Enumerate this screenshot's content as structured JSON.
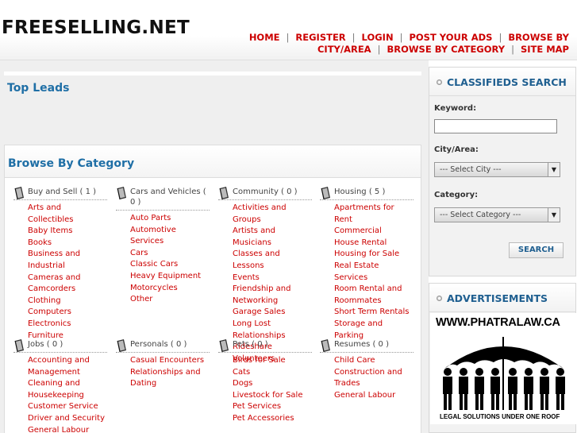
{
  "site": {
    "logo": "FREESELLING.NET"
  },
  "nav": {
    "row1": [
      "HOME",
      "REGISTER",
      "LOGIN",
      "POST YOUR ADS",
      "BROWSE BY"
    ],
    "row2": [
      "CITY/AREA",
      "BROWSE BY CATEGORY",
      "SITE MAP"
    ]
  },
  "top_leads": {
    "title": "Top Leads"
  },
  "browse": {
    "title": "Browse By Category",
    "categories": [
      {
        "name": "Buy and Sell ( 1 )",
        "items": [
          "Arts and Collectibles",
          "Baby Items",
          "Books",
          "Business and Industrial",
          "Cameras and Camcorders",
          "Clothing",
          "Computers",
          "Electronics",
          "Furniture"
        ]
      },
      {
        "name": "Cars and Vehicles ( 0 )",
        "items": [
          "Auto Parts",
          "Automotive Services",
          "Cars",
          "Classic Cars",
          "Heavy Equipment",
          "Motorcycles",
          "Other"
        ]
      },
      {
        "name": "Community ( 0 )",
        "items": [
          "Activities and Groups",
          "Artists and Musicians",
          "Classes and Lessons",
          "Events",
          "Friendship and Networking",
          "Garage Sales",
          "Long Lost Relationships",
          "Rideshare",
          "Volunteers"
        ]
      },
      {
        "name": "Housing ( 5 )",
        "items": [
          "Apartments for Rent",
          "Commercial",
          "House Rental",
          "Housing for Sale",
          "Real Estate Services",
          "Room Rental and Roommates",
          "Short Term Rentals",
          "Storage and Parking"
        ]
      },
      {
        "name": "Jobs ( 0 )",
        "items": [
          "Accounting and Management",
          "Cleaning and Housekeeping",
          "Customer Service",
          "Driver and Security",
          "General Labour"
        ]
      },
      {
        "name": "Personals ( 0 )",
        "items": [
          "Casual Encounters",
          "Relationships and Dating"
        ]
      },
      {
        "name": "Pets ( 0 )",
        "items": [
          "Birds for Sale",
          "Cats",
          "Dogs",
          "Livestock for Sale",
          "Pet Services",
          "Pet Accessories"
        ]
      },
      {
        "name": "Resumes ( 0 )",
        "items": [
          "Child Care",
          "Construction and Trades",
          "General Labour"
        ]
      }
    ]
  },
  "search": {
    "title": "CLASSIFIEDS SEARCH",
    "keyword_label": "Keyword:",
    "keyword_value": "",
    "city_label": "City/Area:",
    "city_value": "---   Select City   ---",
    "category_label": "Category:",
    "category_value": "---   Select Category   ---",
    "button": "SEARCH"
  },
  "ads": {
    "title": "ADVERTISEMENTS",
    "banner_title": "WWW.PHATRALAW.CA",
    "banner_tag": "LEGAL SOLUTIONS UNDER ONE ROOF"
  }
}
